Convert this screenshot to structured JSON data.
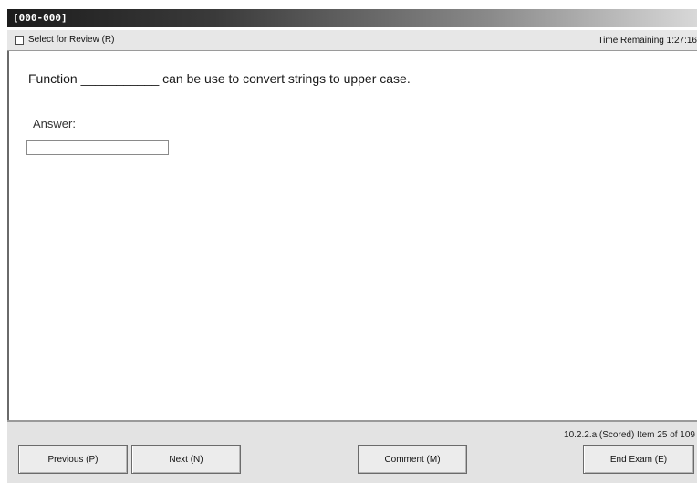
{
  "window": {
    "title": "[000-000]"
  },
  "toolbar": {
    "review_label": "Select for Review (R)",
    "review_checked": false,
    "time_remaining": "Time Remaining 1:27:16"
  },
  "question": {
    "text": "Function ___________ can be use to convert strings to upper case.",
    "answer_label": "Answer:",
    "answer_value": ""
  },
  "footer": {
    "status": "10.2.2.a  (Scored)  Item 25 of 109",
    "buttons": {
      "previous": "Previous (P)",
      "next": "Next (N)",
      "comment": "Comment (M)",
      "end_exam": "End Exam (E)"
    }
  }
}
